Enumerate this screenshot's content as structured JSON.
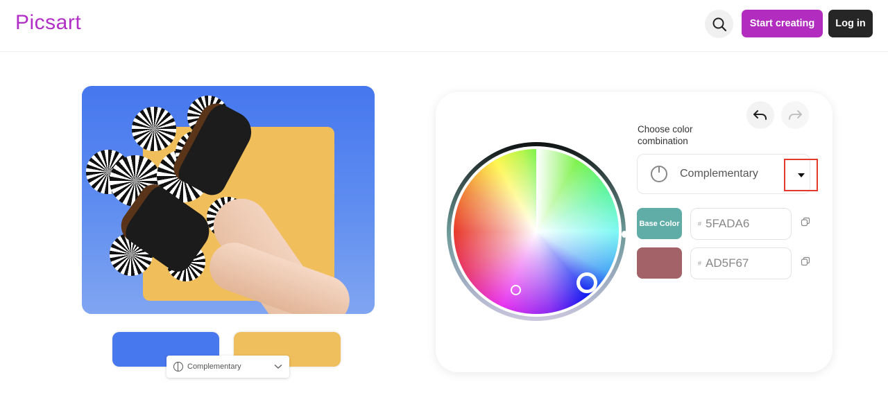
{
  "header": {
    "logo_text": "Picsart",
    "search_icon": "search-icon",
    "start_label": "Start creating",
    "login_label": "Log in",
    "brand_color": "#b22cbf"
  },
  "preview": {
    "image_description": "Legs in black boots with hypnotic checkered circles over a blue background with a yellow square",
    "swatches": [
      {
        "name": "blue",
        "color": "#4878ee"
      },
      {
        "name": "yellow",
        "color": "#f0bf5d"
      }
    ],
    "mini_dropdown": {
      "icon": "harmony-icon",
      "label": "Complementary",
      "chevron_icon": "chevron-down-icon"
    }
  },
  "editor": {
    "undo_icon": "undo-icon",
    "redo_icon": "redo-icon",
    "combo_label": "Choose color combination",
    "combo_select": {
      "icon": "harmony-icon",
      "value": "Complementary",
      "caret_icon": "caret-down-icon"
    },
    "colors": [
      {
        "chip_label": "Base Color",
        "chip_color": "#5FADA6",
        "hash": "#",
        "hex": "5FADA6",
        "copy_icon": "copy-icon"
      },
      {
        "chip_label": "",
        "chip_color": "#AD5F67",
        "hash": "#",
        "hex": "AD5F67",
        "copy_icon": "copy-icon"
      }
    ],
    "highlight_color": "#e5382c"
  }
}
